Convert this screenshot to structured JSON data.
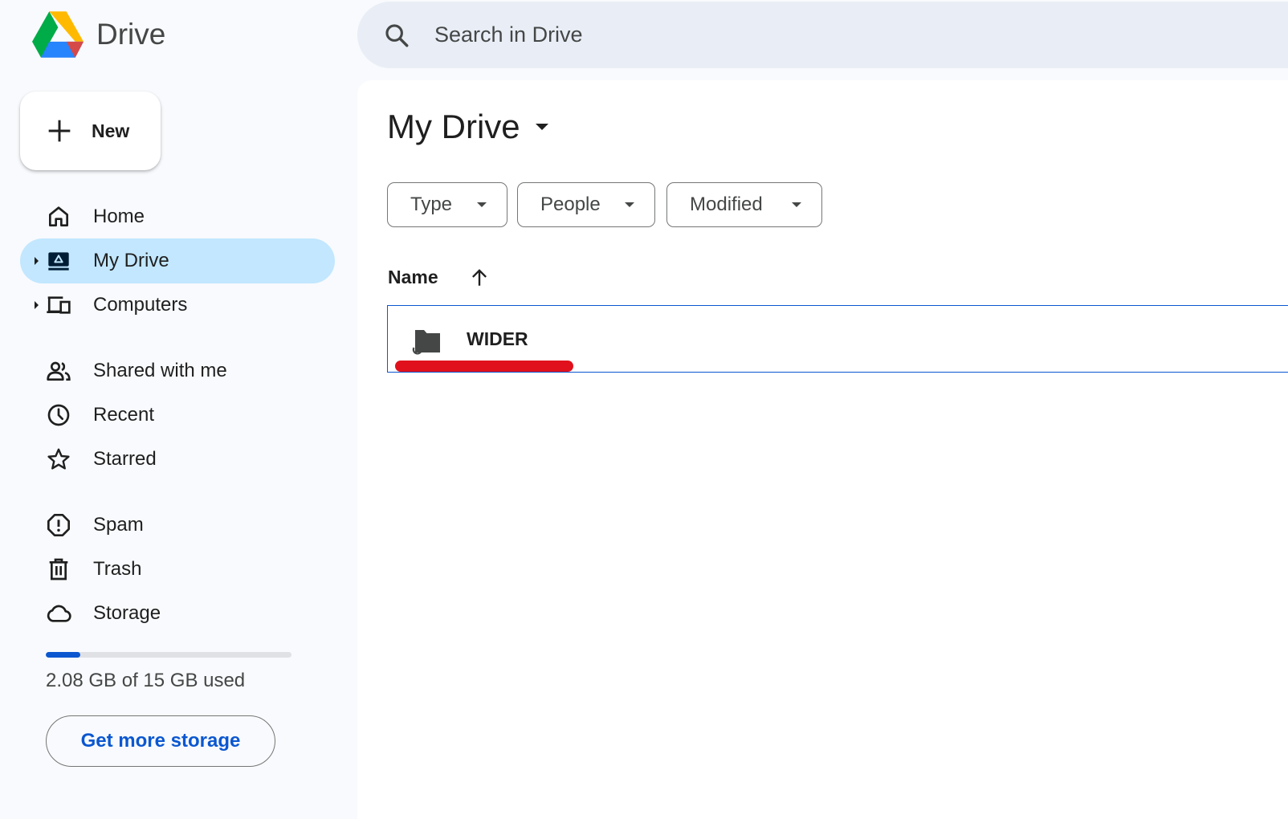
{
  "app": {
    "name": "Drive"
  },
  "search": {
    "placeholder": "Search in Drive"
  },
  "new_button": {
    "label": "New"
  },
  "sidebar": {
    "items": [
      {
        "label": "Home",
        "icon": "home-icon"
      },
      {
        "label": "My Drive",
        "icon": "my-drive-icon",
        "active": true,
        "expandable": true
      },
      {
        "label": "Computers",
        "icon": "computer-icon",
        "expandable": true
      },
      {
        "label": "Shared with me",
        "icon": "people-icon"
      },
      {
        "label": "Recent",
        "icon": "clock-icon"
      },
      {
        "label": "Starred",
        "icon": "star-icon"
      },
      {
        "label": "Spam",
        "icon": "spam-icon"
      },
      {
        "label": "Trash",
        "icon": "trash-icon"
      },
      {
        "label": "Storage",
        "icon": "cloud-icon"
      }
    ]
  },
  "storage": {
    "used_text": "2.08 GB of 15 GB used",
    "used_fraction": 0.139,
    "button_label": "Get more storage"
  },
  "main": {
    "title": "My Drive",
    "filters": [
      {
        "label": "Type"
      },
      {
        "label": "People"
      },
      {
        "label": "Modified"
      }
    ],
    "column_header": "Name",
    "sort": "ascending",
    "files": [
      {
        "name": "WIDER",
        "type": "shared-folder",
        "selected": true,
        "highlighted": true
      }
    ]
  },
  "colors": {
    "accent": "#0b57d0",
    "active_nav": "#c2e7ff",
    "highlight_underline": "#e0111c",
    "search_bg": "#e9eef6"
  }
}
